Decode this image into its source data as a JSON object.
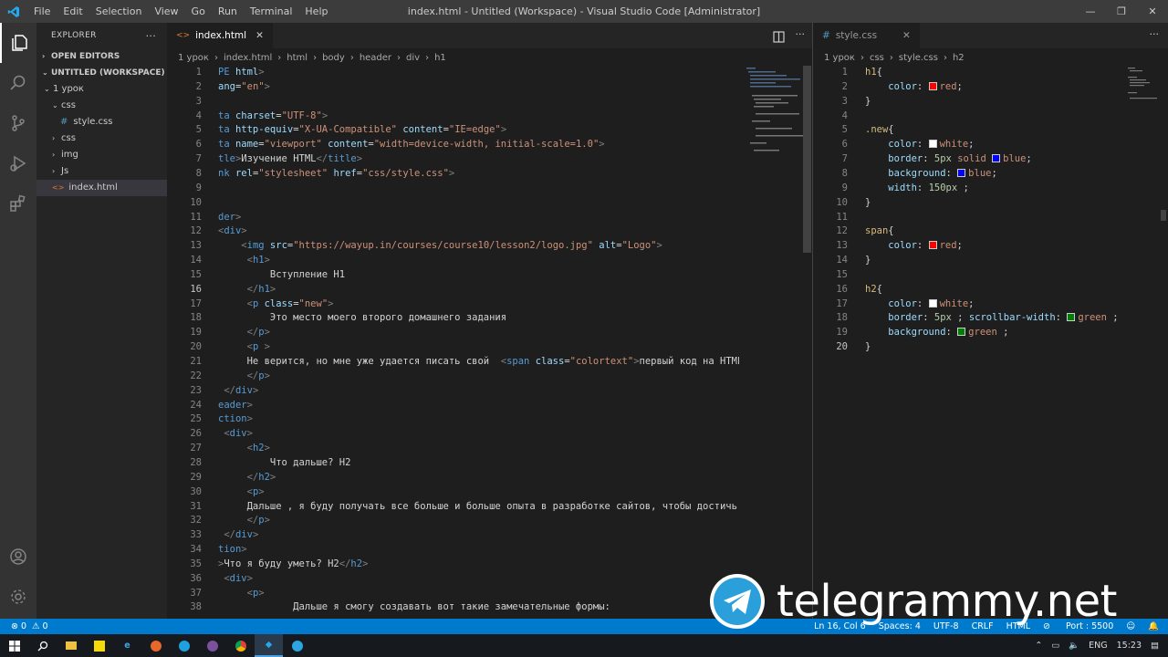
{
  "window": {
    "title": "index.html - Untitled (Workspace) - Visual Studio Code [Administrator]",
    "menu": [
      "File",
      "Edit",
      "Selection",
      "View",
      "Go",
      "Run",
      "Terminal",
      "Help"
    ],
    "controls": [
      "—",
      "❐",
      "✕"
    ]
  },
  "sidebar": {
    "title": "EXPLORER",
    "more": "···",
    "open_editors": "OPEN EDITORS",
    "workspace": "UNTITLED (WORKSPACE)",
    "tree": [
      {
        "label": "1 урок",
        "kind": "folder-open",
        "depth": 0
      },
      {
        "label": "css",
        "kind": "folder-open",
        "depth": 1
      },
      {
        "label": "style.css",
        "kind": "css",
        "depth": 2
      },
      {
        "label": "css",
        "kind": "folder",
        "depth": 1
      },
      {
        "label": "img",
        "kind": "folder",
        "depth": 1
      },
      {
        "label": "Js",
        "kind": "folder",
        "depth": 1
      },
      {
        "label": "index.html",
        "kind": "html",
        "depth": 1,
        "selected": true
      }
    ]
  },
  "left_editor": {
    "tab": "index.html",
    "breadcrumb": [
      "1 урок",
      "index.html",
      "html",
      "body",
      "header",
      "div",
      "h1"
    ],
    "current_line": 16,
    "lines": [
      [
        {
          "c": "t",
          "v": "PE "
        },
        {
          "c": "a",
          "v": "html"
        },
        {
          "c": "p",
          "v": ">"
        }
      ],
      [
        {
          "c": "a",
          "v": "ang"
        },
        {
          "c": "d",
          "v": "="
        },
        {
          "c": "s",
          "v": "\"en\""
        },
        {
          "c": "p",
          "v": ">"
        }
      ],
      [],
      [
        {
          "c": "t",
          "v": "ta "
        },
        {
          "c": "a",
          "v": "charset"
        },
        {
          "c": "d",
          "v": "="
        },
        {
          "c": "s",
          "v": "\"UTF-8\""
        },
        {
          "c": "p",
          "v": ">"
        }
      ],
      [
        {
          "c": "t",
          "v": "ta "
        },
        {
          "c": "a",
          "v": "http-equiv"
        },
        {
          "c": "d",
          "v": "="
        },
        {
          "c": "s",
          "v": "\"X-UA-Compatible\""
        },
        {
          "c": "d",
          "v": " "
        },
        {
          "c": "a",
          "v": "content"
        },
        {
          "c": "d",
          "v": "="
        },
        {
          "c": "s",
          "v": "\"IE=edge\""
        },
        {
          "c": "p",
          "v": ">"
        }
      ],
      [
        {
          "c": "t",
          "v": "ta "
        },
        {
          "c": "a",
          "v": "name"
        },
        {
          "c": "d",
          "v": "="
        },
        {
          "c": "s",
          "v": "\"viewport\""
        },
        {
          "c": "d",
          "v": " "
        },
        {
          "c": "a",
          "v": "content"
        },
        {
          "c": "d",
          "v": "="
        },
        {
          "c": "s",
          "v": "\"width=device-width, initial-scale=1.0\""
        },
        {
          "c": "p",
          "v": ">"
        }
      ],
      [
        {
          "c": "t",
          "v": "tle"
        },
        {
          "c": "p",
          "v": ">"
        },
        {
          "c": "d",
          "v": "Изучение HTML"
        },
        {
          "c": "p",
          "v": "</"
        },
        {
          "c": "t",
          "v": "title"
        },
        {
          "c": "p",
          "v": ">"
        }
      ],
      [
        {
          "c": "t",
          "v": "nk "
        },
        {
          "c": "a",
          "v": "rel"
        },
        {
          "c": "d",
          "v": "="
        },
        {
          "c": "s",
          "v": "\"stylesheet\""
        },
        {
          "c": "d",
          "v": " "
        },
        {
          "c": "a",
          "v": "href"
        },
        {
          "c": "d",
          "v": "="
        },
        {
          "c": "s",
          "v": "\"css/style.css\""
        },
        {
          "c": "p",
          "v": ">"
        }
      ],
      [],
      [],
      [
        {
          "c": "t",
          "v": "der"
        },
        {
          "c": "p",
          "v": ">"
        }
      ],
      [
        {
          "c": "p",
          "v": "<"
        },
        {
          "c": "t",
          "v": "div"
        },
        {
          "c": "p",
          "v": ">"
        }
      ],
      [
        {
          "c": "d",
          "v": "    "
        },
        {
          "c": "p",
          "v": "<"
        },
        {
          "c": "t",
          "v": "img "
        },
        {
          "c": "a",
          "v": "src"
        },
        {
          "c": "d",
          "v": "="
        },
        {
          "c": "s",
          "v": "\"https://wayup.in/courses/course10/lesson2/logo.jpg\""
        },
        {
          "c": "d",
          "v": " "
        },
        {
          "c": "a",
          "v": "alt"
        },
        {
          "c": "d",
          "v": "="
        },
        {
          "c": "s",
          "v": "\"Logo\""
        },
        {
          "c": "p",
          "v": ">"
        }
      ],
      [
        {
          "c": "d",
          "v": "     "
        },
        {
          "c": "p",
          "v": "<"
        },
        {
          "c": "t",
          "v": "h1"
        },
        {
          "c": "p",
          "v": ">"
        }
      ],
      [
        {
          "c": "d",
          "v": "         Вступление H1"
        }
      ],
      [
        {
          "c": "d",
          "v": "     "
        },
        {
          "c": "p",
          "v": "</"
        },
        {
          "c": "t",
          "v": "h1"
        },
        {
          "c": "p",
          "v": ">"
        }
      ],
      [
        {
          "c": "d",
          "v": "     "
        },
        {
          "c": "p",
          "v": "<"
        },
        {
          "c": "t",
          "v": "p "
        },
        {
          "c": "a",
          "v": "class"
        },
        {
          "c": "d",
          "v": "="
        },
        {
          "c": "s",
          "v": "\"new\""
        },
        {
          "c": "p",
          "v": ">"
        }
      ],
      [
        {
          "c": "d",
          "v": "         Это место моего второго домашнего задания"
        }
      ],
      [
        {
          "c": "d",
          "v": "     "
        },
        {
          "c": "p",
          "v": "</"
        },
        {
          "c": "t",
          "v": "p"
        },
        {
          "c": "p",
          "v": ">"
        }
      ],
      [
        {
          "c": "d",
          "v": "     "
        },
        {
          "c": "p",
          "v": "<"
        },
        {
          "c": "t",
          "v": "p "
        },
        {
          "c": "p",
          "v": ">"
        }
      ],
      [
        {
          "c": "d",
          "v": "     Не верится, но мне уже удается писать свой  "
        },
        {
          "c": "p",
          "v": "<"
        },
        {
          "c": "t",
          "v": "span "
        },
        {
          "c": "a",
          "v": "class"
        },
        {
          "c": "d",
          "v": "="
        },
        {
          "c": "s",
          "v": "\"colortext\""
        },
        {
          "c": "p",
          "v": ">"
        },
        {
          "c": "d",
          "v": "первый код на HTML"
        }
      ],
      [
        {
          "c": "d",
          "v": "     "
        },
        {
          "c": "p",
          "v": "</"
        },
        {
          "c": "t",
          "v": "p"
        },
        {
          "c": "p",
          "v": ">"
        }
      ],
      [
        {
          "c": "d",
          "v": " "
        },
        {
          "c": "p",
          "v": "</"
        },
        {
          "c": "t",
          "v": "div"
        },
        {
          "c": "p",
          "v": ">"
        }
      ],
      [
        {
          "c": "t",
          "v": "eader"
        },
        {
          "c": "p",
          "v": ">"
        }
      ],
      [
        {
          "c": "t",
          "v": "ction"
        },
        {
          "c": "p",
          "v": ">"
        }
      ],
      [
        {
          "c": "d",
          "v": " "
        },
        {
          "c": "p",
          "v": "<"
        },
        {
          "c": "t",
          "v": "div"
        },
        {
          "c": "p",
          "v": ">"
        }
      ],
      [
        {
          "c": "d",
          "v": "     "
        },
        {
          "c": "p",
          "v": "<"
        },
        {
          "c": "t",
          "v": "h2"
        },
        {
          "c": "p",
          "v": ">"
        }
      ],
      [
        {
          "c": "d",
          "v": "         Что дальше? H2"
        }
      ],
      [
        {
          "c": "d",
          "v": "     "
        },
        {
          "c": "p",
          "v": "</"
        },
        {
          "c": "t",
          "v": "h2"
        },
        {
          "c": "p",
          "v": ">"
        }
      ],
      [
        {
          "c": "d",
          "v": "     "
        },
        {
          "c": "p",
          "v": "<"
        },
        {
          "c": "t",
          "v": "p"
        },
        {
          "c": "p",
          "v": ">"
        }
      ],
      [
        {
          "c": "d",
          "v": "     Дальше , я буду получать все больше и больше опыта в разработке сайтов, чтобы достичь"
        }
      ],
      [
        {
          "c": "d",
          "v": "     "
        },
        {
          "c": "p",
          "v": "</"
        },
        {
          "c": "t",
          "v": "p"
        },
        {
          "c": "p",
          "v": ">"
        }
      ],
      [
        {
          "c": "d",
          "v": " "
        },
        {
          "c": "p",
          "v": "</"
        },
        {
          "c": "t",
          "v": "div"
        },
        {
          "c": "p",
          "v": ">"
        }
      ],
      [
        {
          "c": "t",
          "v": "tion"
        },
        {
          "c": "p",
          "v": ">"
        }
      ],
      [
        {
          "c": "p",
          "v": ">"
        },
        {
          "c": "d",
          "v": "Что я буду уметь? H2"
        },
        {
          "c": "p",
          "v": "</"
        },
        {
          "c": "t",
          "v": "h2"
        },
        {
          "c": "p",
          "v": ">"
        }
      ],
      [
        {
          "c": "d",
          "v": " "
        },
        {
          "c": "p",
          "v": "<"
        },
        {
          "c": "t",
          "v": "div"
        },
        {
          "c": "p",
          "v": ">"
        }
      ],
      [
        {
          "c": "d",
          "v": "     "
        },
        {
          "c": "p",
          "v": "<"
        },
        {
          "c": "t",
          "v": "p"
        },
        {
          "c": "p",
          "v": ">"
        }
      ],
      [
        {
          "c": "d",
          "v": "             Дальше я смогу создавать вот такие замечательные формы:"
        }
      ]
    ]
  },
  "right_editor": {
    "tab": "style.css",
    "breadcrumb": [
      "1 урок",
      "css",
      "style.css",
      "h2"
    ],
    "current_line": 20,
    "lines": [
      [
        {
          "c": "sel2",
          "v": "h1"
        },
        {
          "c": "d",
          "v": "{"
        }
      ],
      [
        {
          "c": "d",
          "v": "    "
        },
        {
          "c": "pr",
          "v": "color"
        },
        {
          "c": "d",
          "v": ": "
        },
        {
          "c": "sw",
          "v": "#ff0000"
        },
        {
          "c": "v",
          "v": "red"
        },
        {
          "c": "d",
          "v": ";"
        }
      ],
      [
        {
          "c": "d",
          "v": "}"
        }
      ],
      [],
      [
        {
          "c": "sel2",
          "v": ".new"
        },
        {
          "c": "d",
          "v": "{"
        }
      ],
      [
        {
          "c": "d",
          "v": "    "
        },
        {
          "c": "pr",
          "v": "color"
        },
        {
          "c": "d",
          "v": ": "
        },
        {
          "c": "sw",
          "v": "#ffffff"
        },
        {
          "c": "v",
          "v": "white"
        },
        {
          "c": "d",
          "v": ";"
        }
      ],
      [
        {
          "c": "d",
          "v": "    "
        },
        {
          "c": "pr",
          "v": "border"
        },
        {
          "c": "d",
          "v": ": "
        },
        {
          "c": "num",
          "v": "5px"
        },
        {
          "c": "d",
          "v": " "
        },
        {
          "c": "v",
          "v": "solid"
        },
        {
          "c": "d",
          "v": " "
        },
        {
          "c": "sw",
          "v": "#0000ff"
        },
        {
          "c": "v",
          "v": "blue"
        },
        {
          "c": "d",
          "v": ";"
        }
      ],
      [
        {
          "c": "d",
          "v": "    "
        },
        {
          "c": "pr",
          "v": "background"
        },
        {
          "c": "d",
          "v": ": "
        },
        {
          "c": "sw",
          "v": "#0000ff"
        },
        {
          "c": "v",
          "v": "blue"
        },
        {
          "c": "d",
          "v": ";"
        }
      ],
      [
        {
          "c": "d",
          "v": "    "
        },
        {
          "c": "pr",
          "v": "width"
        },
        {
          "c": "d",
          "v": ": "
        },
        {
          "c": "num",
          "v": "150px"
        },
        {
          "c": "d",
          "v": " ;"
        }
      ],
      [
        {
          "c": "d",
          "v": "}"
        }
      ],
      [],
      [
        {
          "c": "sel2",
          "v": "span"
        },
        {
          "c": "d",
          "v": "{"
        }
      ],
      [
        {
          "c": "d",
          "v": "    "
        },
        {
          "c": "pr",
          "v": "color"
        },
        {
          "c": "d",
          "v": ": "
        },
        {
          "c": "sw",
          "v": "#ff0000"
        },
        {
          "c": "v",
          "v": "red"
        },
        {
          "c": "d",
          "v": ";"
        }
      ],
      [
        {
          "c": "d",
          "v": "}"
        }
      ],
      [],
      [
        {
          "c": "sel2",
          "v": "h2"
        },
        {
          "c": "d",
          "v": "{"
        }
      ],
      [
        {
          "c": "d",
          "v": "    "
        },
        {
          "c": "pr",
          "v": "color"
        },
        {
          "c": "d",
          "v": ": "
        },
        {
          "c": "sw",
          "v": "#ffffff"
        },
        {
          "c": "v",
          "v": "white"
        },
        {
          "c": "d",
          "v": ";"
        }
      ],
      [
        {
          "c": "d",
          "v": "    "
        },
        {
          "c": "pr",
          "v": "border"
        },
        {
          "c": "d",
          "v": ": "
        },
        {
          "c": "num",
          "v": "5px"
        },
        {
          "c": "d",
          "v": " ; "
        },
        {
          "c": "pr",
          "v": "scrollbar-width"
        },
        {
          "c": "d",
          "v": ": "
        },
        {
          "c": "sw",
          "v": "#008000"
        },
        {
          "c": "v",
          "v": "green"
        },
        {
          "c": "d",
          "v": " ;"
        }
      ],
      [
        {
          "c": "d",
          "v": "    "
        },
        {
          "c": "pr",
          "v": "background"
        },
        {
          "c": "d",
          "v": ": "
        },
        {
          "c": "sw",
          "v": "#008000"
        },
        {
          "c": "v",
          "v": "green"
        },
        {
          "c": "d",
          "v": " ;"
        }
      ],
      [
        {
          "c": "d",
          "v": "}"
        }
      ]
    ]
  },
  "status": {
    "errors": "0",
    "warnings": "0",
    "position": "Ln 16, Col 6",
    "spaces": "Spaces: 4",
    "encoding": "UTF-8",
    "eol": "CRLF",
    "language": "HTML",
    "port": "Port : 5500"
  },
  "taskbar": {
    "lang": "ENG",
    "time": "15:23"
  },
  "watermark": "telegrammy.net",
  "colors": {
    "accent": "#007acc",
    "titlebar": "#3c3c3c",
    "activity": "#333333",
    "sidebar": "#252526",
    "editor": "#1e1e1e"
  }
}
